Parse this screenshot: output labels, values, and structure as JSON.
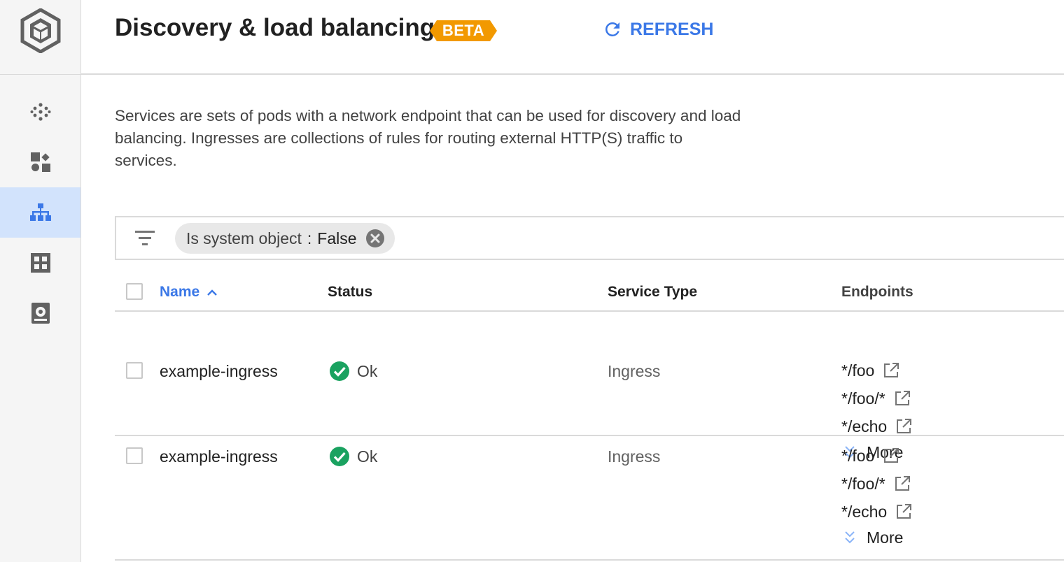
{
  "header": {
    "title": "Discovery & load balancing",
    "badge": "BETA",
    "refresh_label": "REFRESH",
    "badge_color": "#f29900",
    "accent_color": "#3b78e7"
  },
  "sidebar": {
    "items": [
      {
        "icon": "cluster-icon"
      },
      {
        "icon": "workloads-icon"
      },
      {
        "icon": "discovery-icon",
        "active": true
      },
      {
        "icon": "configuration-icon"
      },
      {
        "icon": "storage-icon"
      }
    ]
  },
  "description": "Services are sets of pods with a network endpoint that can be used for discovery and load balancing. Ingresses are collections of rules for routing external HTTP(S) traffic to services.",
  "filter": {
    "key": "Is system object",
    "separator": ":",
    "value": "False"
  },
  "table": {
    "columns": [
      "Name",
      "Status",
      "Service Type",
      "Endpoints"
    ],
    "rows": [
      {
        "name": "example-ingress",
        "status": "Ok",
        "type": "Ingress",
        "endpoints": [
          "*/foo",
          "*/foo/*",
          "*/echo"
        ],
        "more": "More"
      },
      {
        "name": "example-ingress",
        "status": "Ok",
        "type": "Ingress",
        "endpoints": [
          "*/foo",
          "*/foo/*",
          "*/echo"
        ],
        "more": "More"
      }
    ]
  }
}
